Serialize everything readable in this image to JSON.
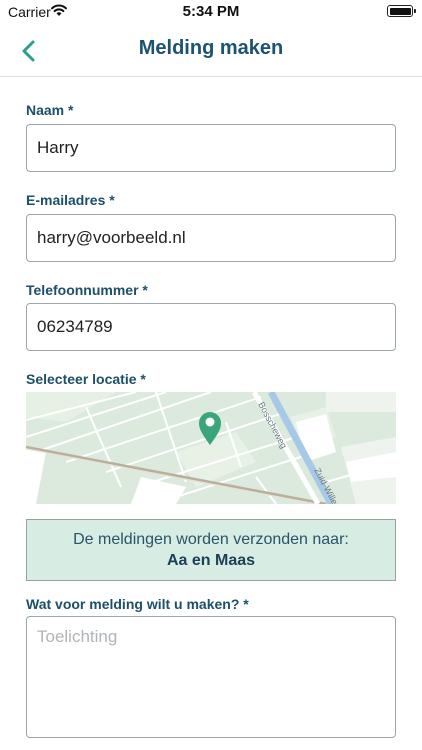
{
  "status_bar": {
    "carrier": "Carrier",
    "time": "5:34 PM"
  },
  "nav": {
    "title": "Melding maken"
  },
  "form": {
    "name": {
      "label": "Naam *",
      "value": "Harry"
    },
    "email": {
      "label": "E-mailadres *",
      "value": "harry@voorbeeld.nl"
    },
    "phone": {
      "label": "Telefoonnummer *",
      "value": "06234789"
    },
    "location": {
      "label": "Selecteer locatie *",
      "streets": [
        "Bosscheweg",
        "Zuid-Willemsvaart"
      ]
    },
    "recipient": {
      "text": "De meldingen worden verzonden naar:",
      "municipality": "Aa en Maas"
    },
    "description": {
      "label": "Wat voor melding wilt u maken? *",
      "placeholder": "Toelichting"
    }
  },
  "colors": {
    "accent": "#1c5272",
    "map_marker": "#3aa57a",
    "info_bg": "#d7ede4"
  },
  "icons": {
    "back": "chevron-left-icon",
    "wifi": "wifi-icon",
    "battery": "battery-icon",
    "marker": "map-pin-icon"
  }
}
